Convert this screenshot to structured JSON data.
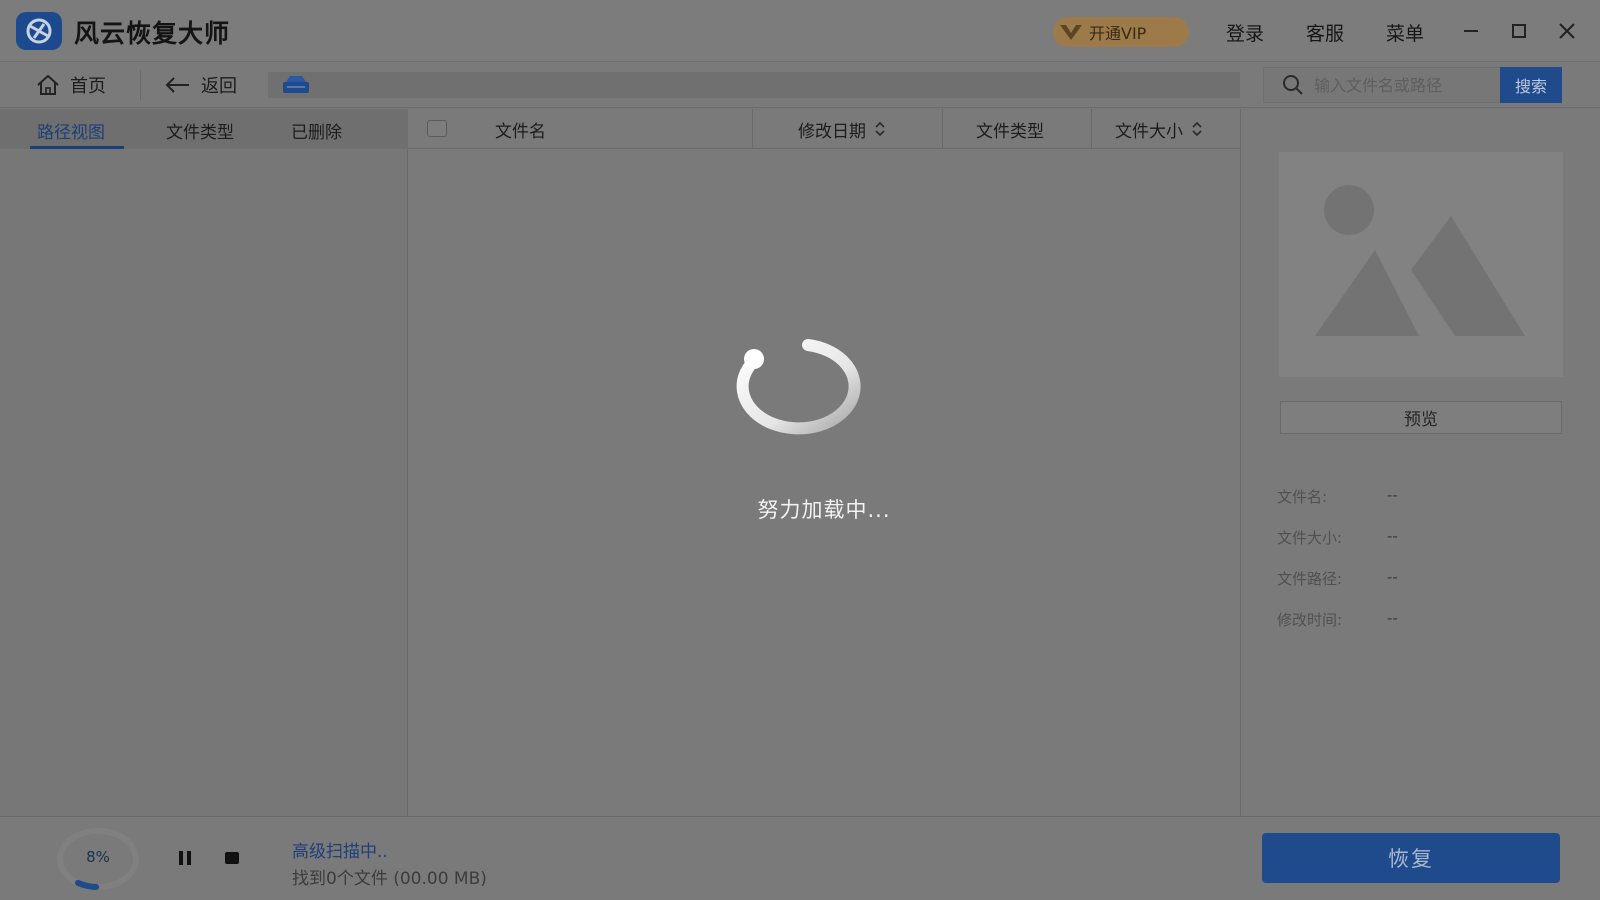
{
  "app": {
    "title": "风云恢复大师",
    "logo_icon": "app-logo-icon"
  },
  "titlebar": {
    "vip_label": "开通VIP",
    "login_label": "登录",
    "support_label": "客服",
    "menu_label": "菜单"
  },
  "nav": {
    "home_label": "首页",
    "back_label": "返回",
    "drive_icon": "drive-icon",
    "search": {
      "placeholder": "输入文件名或路径",
      "button_label": "搜索"
    }
  },
  "left_tabs": {
    "items": [
      "路径视图",
      "文件类型",
      "已删除"
    ],
    "active_index": 0
  },
  "table": {
    "columns": [
      "文件名",
      "修改日期",
      "文件类型",
      "文件大小"
    ],
    "loading_text": "努力加载中..."
  },
  "preview": {
    "button_label": "预览",
    "fields": [
      {
        "label": "文件名:",
        "value": "--"
      },
      {
        "label": "文件大小:",
        "value": "--"
      },
      {
        "label": "文件路径:",
        "value": "--"
      },
      {
        "label": "修改时间:",
        "value": "--"
      }
    ]
  },
  "bottom": {
    "progress_text": "8%",
    "progress_fraction": 0.08,
    "scan_status": "高级扫描中..",
    "found_text": "找到0个文件 (00.00 MB)",
    "recover_label": "恢复"
  },
  "colors": {
    "accent": "#1f4a8c",
    "overlay_bg": "#7a7a7a",
    "vip_gold": "#9c7a4a"
  }
}
